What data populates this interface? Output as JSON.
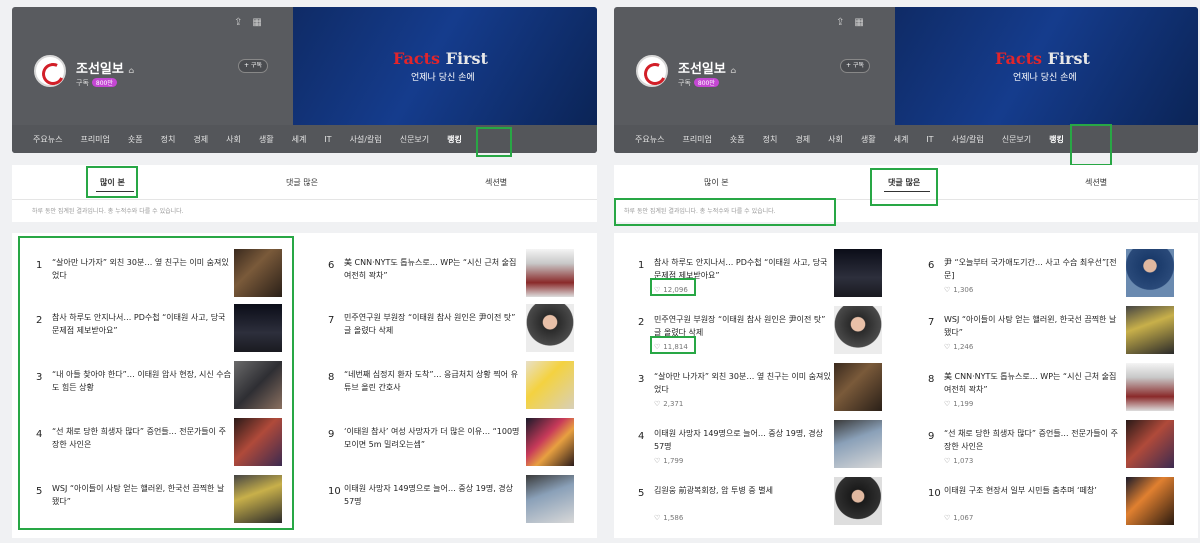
{
  "colors": {
    "highlight": "#28a745",
    "banner": "#153c8d",
    "header_bg": "#595b5f",
    "badge": "#c547d4"
  },
  "header": {
    "publisher_name": "조선일보",
    "subscribe_label": "구독",
    "subscriber_badge": "800만",
    "subscribe_button": "+ 구독",
    "banner_title_red": "Facts",
    "banner_title_white": "First",
    "banner_subtitle": "언제나 당신 손에",
    "icons": [
      "share-icon",
      "grid-icon",
      "home-icon"
    ]
  },
  "nav": {
    "items": [
      "주요뉴스",
      "프리미엄",
      "숏폼",
      "정치",
      "경제",
      "사회",
      "생활",
      "세계",
      "IT",
      "사설/칼럼",
      "신문보기",
      "랭킹"
    ],
    "active": "랭킹"
  },
  "tabs": {
    "labels": [
      "많이 본",
      "댓글 많은",
      "섹션별"
    ]
  },
  "panels": [
    {
      "note": "하루 동안 집계된 결과입니다. 총 누적수와 다를 수 있습니다.",
      "items": [
        {
          "rank": "1",
          "title": "“살아만 나가자” 외친 30분… 옆 친구는 이미 숨져있었다"
        },
        {
          "rank": "2",
          "title": "참사 하루도 안지나서… PD수첩 “이태원 사고, 당국 문제점 제보받아요”"
        },
        {
          "rank": "3",
          "title": "“내 아들 찾아야 한다”… 이태원 압사 현장, 시신 수습도 힘든 상황"
        },
        {
          "rank": "4",
          "title": "“선 채로 당한 희생자 많다” 증언들… 전문가들이 주장한 사인은"
        },
        {
          "rank": "5",
          "title": "WSJ “아이들이 사탕 얻는 핼러윈, 한국선 끔찍한 날 됐다”"
        },
        {
          "rank": "6",
          "title": "美 CNN·NYT도 톱뉴스로… WP는 “시신 근처 술집 여전히 꽉차”"
        },
        {
          "rank": "7",
          "title": "민주연구원 부원장 “이태원 참사 원인은 尹이전 탓” 글 올렸다 삭제"
        },
        {
          "rank": "8",
          "title": "“네번째 심정지 환자 도착”… 응급처치 상황 찍어 유튜브 올린 간호사"
        },
        {
          "rank": "9",
          "title": "‘이태원 참사’ 여성 사망자가 더 많은 이유… “100명 모이면 5m 밀려오는셈”"
        },
        {
          "rank": "10",
          "title": "이태원 사망자 149명으로 늘어… 중상 19명, 경상 57명"
        }
      ]
    },
    {
      "note": "하루 동안 집계된 결과입니다. 총 누적수와 다를 수 있습니다.",
      "items": [
        {
          "rank": "1",
          "title": "참사 하루도 안지나서… PD수첩 “이태원 사고, 당국 문제점 제보받아요”",
          "comments": "12,096"
        },
        {
          "rank": "2",
          "title": "민주연구원 부원장 “이태원 참사 원인은 尹이전 탓” 글 올렸다 삭제",
          "comments": "11,814"
        },
        {
          "rank": "3",
          "title": "“살아만 나가자” 외친 30분… 옆 친구는 이미 숨져있었다",
          "comments": "2,371"
        },
        {
          "rank": "4",
          "title": "이태원 사망자 149명으로 늘어… 중상 19명, 경상 57명",
          "comments": "1,799"
        },
        {
          "rank": "5",
          "title": "김원웅 前광복회장, 암 투병 중 별세",
          "comments": "1,586"
        },
        {
          "rank": "6",
          "title": "尹 “오늘부터 국가애도기간… 사고 수습 최우선”[전문]",
          "comments": "1,306"
        },
        {
          "rank": "7",
          "title": "WSJ “아이들이 사탕 얻는 핼러윈, 한국선 끔찍한 날 됐다”",
          "comments": "1,246"
        },
        {
          "rank": "8",
          "title": "美 CNN·NYT도 톱뉴스로… WP는 “시신 근처 술집 여전히 꽉차”",
          "comments": "1,199"
        },
        {
          "rank": "9",
          "title": "“선 채로 당한 희생자 많다” 증언들… 전문가들이 주장한 사인은",
          "comments": "1,073"
        },
        {
          "rank": "10",
          "title": "이태원 구조 현장서 일부 시민들 춤추며 ‘떼창’",
          "comments": "1,067"
        }
      ]
    }
  ]
}
